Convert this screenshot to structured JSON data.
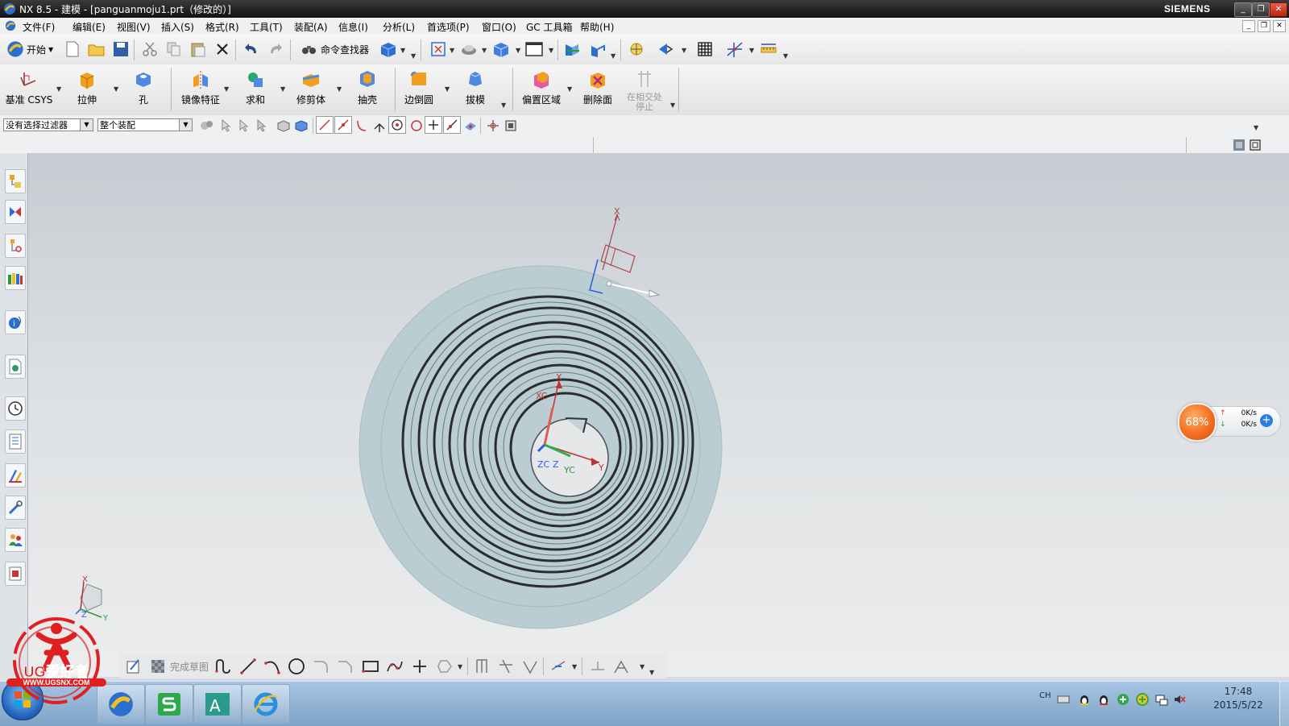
{
  "window": {
    "title": "NX 8.5 - 建模 - [panguanmoju1.prt（修改的）]",
    "brand": "SIEMENS"
  },
  "menu": [
    "文件(F)",
    "编辑(E)",
    "视图(V)",
    "插入(S)",
    "格式(R)",
    "工具(T)",
    "装配(A)",
    "信息(I)",
    "分析(L)",
    "首选项(P)",
    "窗口(O)",
    "GC 工具箱",
    "帮助(H)"
  ],
  "toolbar1": {
    "start_label": "开始",
    "command_finder_label": "命令查找器"
  },
  "feature_toolbar": {
    "datum_csys": "基准 CSYS",
    "extrude": "拉伸",
    "hole": "孔",
    "mirror_feature": "镜像特征",
    "unite": "求和",
    "trim_body": "修剪体",
    "shell": "抽壳",
    "edge_blend": "边倒圆",
    "draft": "拔模",
    "offset_region": "偏置区域",
    "delete_face": "删除面",
    "stop_at_intersection": "在相交处停止"
  },
  "selection_bar": {
    "filter_value": "没有选择过滤器",
    "scope_value": "整个装配"
  },
  "sketch_toolbar": {
    "finish_sketch": "完成草图"
  },
  "viewport": {
    "csys_labels": {
      "x_top": "X",
      "xc": "XC",
      "zc": "ZC",
      "z": "Z",
      "yc": "YC",
      "y": "Y"
    },
    "triad_labels": {
      "x": "X",
      "z": "Z",
      "y": "Y"
    }
  },
  "speed_widget": {
    "percent": "68%",
    "up": "0K/s",
    "down": "0K/s"
  },
  "watermark": {
    "brand": "UG爱好者",
    "url": "WWW.UGSNX.COM"
  },
  "taskbar": {
    "ime": "CH",
    "time": "17:48",
    "date": "2015/5/22"
  }
}
